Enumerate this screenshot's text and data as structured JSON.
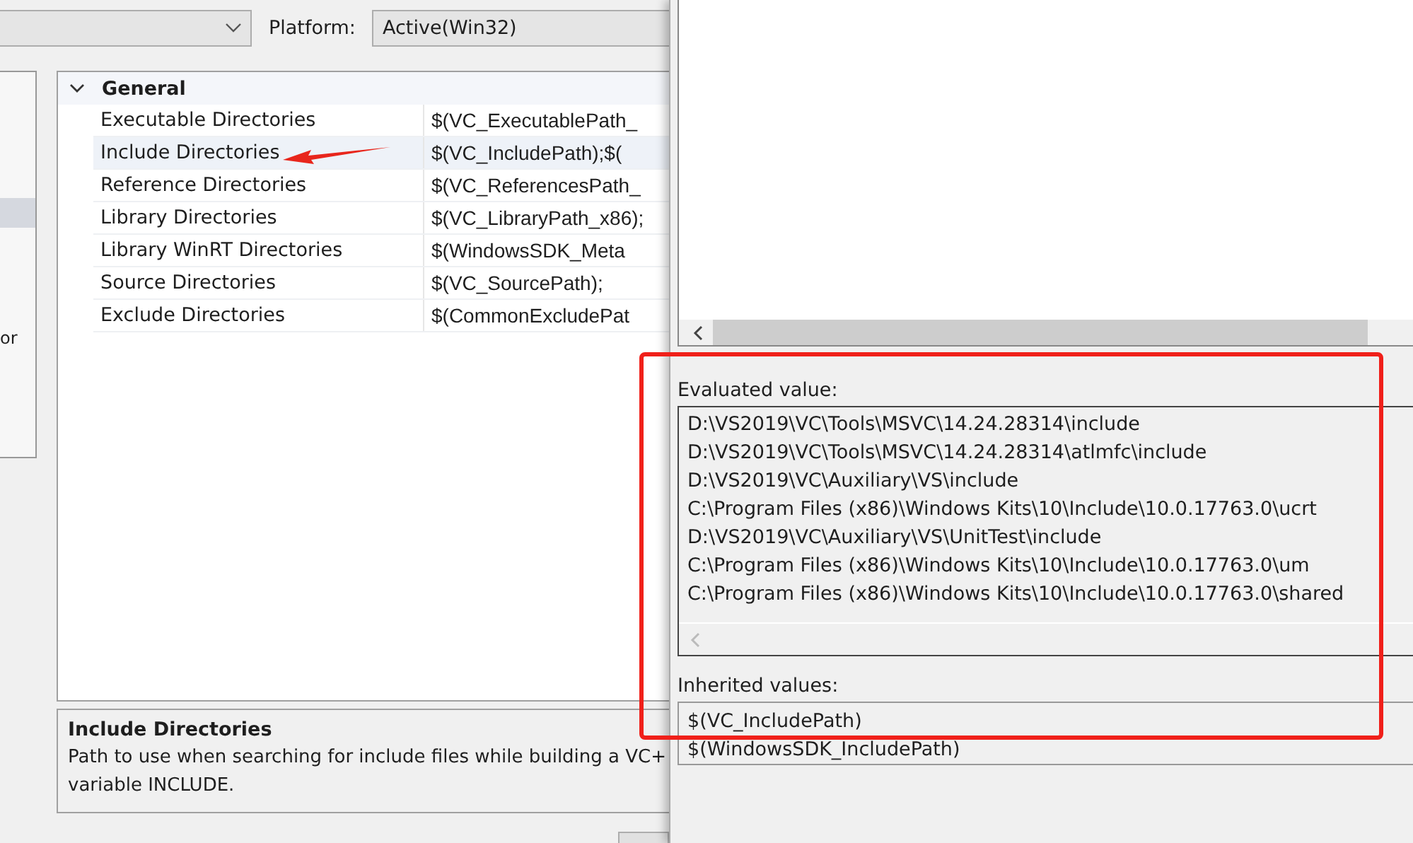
{
  "toolbar": {
    "platform_label": "Platform:",
    "platform": {
      "value": "Active(Win32)"
    }
  },
  "sidebar": {
    "items": [
      {
        "selected": true
      },
      {
        "label": "or",
        "selected": false
      }
    ]
  },
  "property_grid": {
    "group": {
      "title": "General",
      "expanded": true
    },
    "rows": [
      {
        "name": "Executable Directories",
        "value": "$(VC_ExecutablePath_",
        "selected": false
      },
      {
        "name": "Include Directories",
        "value": "$(VC_IncludePath);$(",
        "selected": true
      },
      {
        "name": "Reference Directories",
        "value": "$(VC_ReferencesPath_",
        "selected": false
      },
      {
        "name": "Library Directories",
        "value": "$(VC_LibraryPath_x86);",
        "selected": false
      },
      {
        "name": "Library WinRT Directories",
        "value": "$(WindowsSDK_Meta",
        "selected": false
      },
      {
        "name": "Source Directories",
        "value": "$(VC_SourcePath);",
        "selected": false
      },
      {
        "name": "Exclude Directories",
        "value": "$(CommonExcludePat",
        "selected": false
      }
    ]
  },
  "description": {
    "title": "Include Directories",
    "lines": [
      "Path to use when searching for include files while building a VC+",
      "variable INCLUDE."
    ]
  },
  "editor_dialog": {
    "evaluated_label": "Evaluated value:",
    "evaluated_lines": [
      "D:\\VS2019\\VC\\Tools\\MSVC\\14.24.28314\\include",
      "D:\\VS2019\\VC\\Tools\\MSVC\\14.24.28314\\atlmfc\\include",
      "D:\\VS2019\\VC\\Auxiliary\\VS\\include",
      "C:\\Program Files (x86)\\Windows Kits\\10\\Include\\10.0.17763.0\\ucrt",
      "D:\\VS2019\\VC\\Auxiliary\\VS\\UnitTest\\include",
      "C:\\Program Files (x86)\\Windows Kits\\10\\Include\\10.0.17763.0\\um",
      "C:\\Program Files (x86)\\Windows Kits\\10\\Include\\10.0.17763.0\\shared"
    ],
    "inherited_label": "Inherited values:",
    "inherited_lines": [
      "$(VC_IncludePath)",
      "$(WindowsSDK_IncludePath)"
    ]
  }
}
